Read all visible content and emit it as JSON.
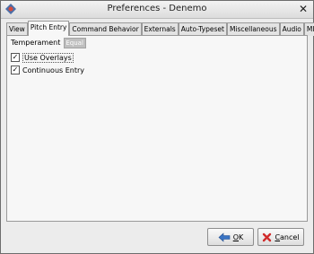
{
  "window": {
    "title": "Preferences - Denemo",
    "close_glyph": "✕"
  },
  "tabs": [
    {
      "label": "View"
    },
    {
      "label": "Pitch Entry"
    },
    {
      "label": "Command Behavior"
    },
    {
      "label": "Externals"
    },
    {
      "label": "Auto-Typeset"
    },
    {
      "label": "Miscellaneous"
    },
    {
      "label": "Audio"
    },
    {
      "label": "MIDI"
    }
  ],
  "active_tab": "Pitch Entry",
  "pitch_entry": {
    "temperament_label": "Temperament",
    "temperament_value": "Equal",
    "use_overlays": {
      "label": "Use Overlays",
      "checked": true
    },
    "continuous_entry": {
      "label": "Continuous Entry",
      "checked": true
    }
  },
  "buttons": {
    "ok": {
      "mnemonic": "O",
      "rest": "K",
      "icon": "back-arrow-icon"
    },
    "cancel": {
      "mnemonic": "C",
      "rest": "ancel",
      "icon": "cancel-x-icon"
    }
  },
  "colors": {
    "ok_arrow": "#3a74c4",
    "cancel_x": "#d02a2a"
  }
}
